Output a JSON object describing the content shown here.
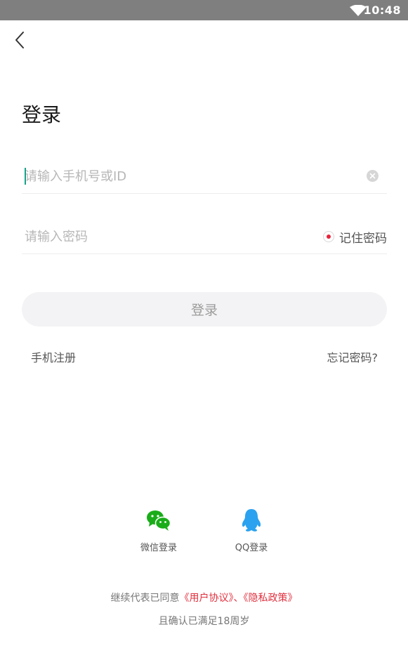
{
  "status_bar": {
    "time": "10:48",
    "wifi_icon": "wifi-icon"
  },
  "header": {
    "back_icon": "chevron-left-icon",
    "title": "登录"
  },
  "form": {
    "phone_placeholder": "请输入手机号或ID",
    "phone_value": "",
    "clear_icon": "clear-icon",
    "password_placeholder": "请输入密码",
    "password_value": "",
    "remember_label": "记住密码",
    "remember_checked": true,
    "login_label": "登录"
  },
  "links": {
    "register": "手机注册",
    "forgot": "忘记密码?"
  },
  "social": [
    {
      "label": "微信登录",
      "icon": "wechat-icon",
      "color": "#1aad19"
    },
    {
      "label": "QQ登录",
      "icon": "qq-icon",
      "color": "#2aa2f0"
    }
  ],
  "agreement": {
    "prefix": "继续代表已同意",
    "user_agreement": "《用户协议》",
    "separator": "、",
    "privacy_policy": "《隐私政策》",
    "line2": "且确认已满足18周岁"
  },
  "colors": {
    "status_bar": "#7f7f7f",
    "accent_red": "#e0303e",
    "caret": "#16a28a",
    "button_bg": "#f3f3f5"
  }
}
